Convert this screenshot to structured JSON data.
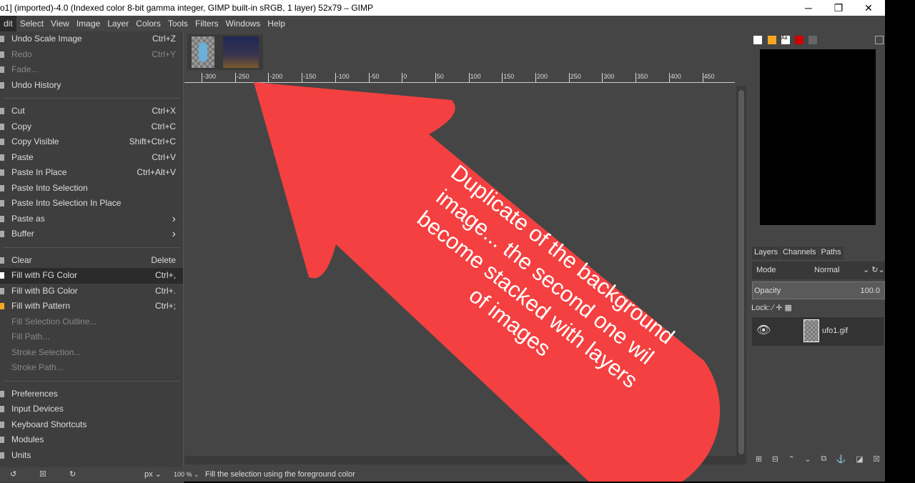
{
  "window": {
    "title": "o1] (imported)-4.0 (Indexed color 8-bit gamma integer, GIMP built-in sRGB, 1 layer) 52x79 – GIMP",
    "minimize": "─",
    "maximize": "❐",
    "close": "✕"
  },
  "menubar": [
    "dit",
    "Select",
    "View",
    "Image",
    "Layer",
    "Colors",
    "Tools",
    "Filters",
    "Windows",
    "Help"
  ],
  "edit_menu": [
    {
      "label": "Undo Scale Image",
      "shortcut": "Ctrl+Z",
      "icon": "undo-icon"
    },
    {
      "label": "Redo",
      "shortcut": "Ctrl+Y",
      "disabled": true,
      "icon": "redo-icon"
    },
    {
      "label": "Fade...",
      "disabled": true,
      "icon": "fade-icon"
    },
    {
      "label": "Undo History",
      "icon": "history-icon"
    },
    {
      "sep": true
    },
    {
      "label": "Cut",
      "shortcut": "Ctrl+X",
      "icon": "cut-icon"
    },
    {
      "label": "Copy",
      "shortcut": "Ctrl+C",
      "icon": "copy-icon"
    },
    {
      "label": "Copy Visible",
      "shortcut": "Shift+Ctrl+C",
      "icon": "copy-visible-icon"
    },
    {
      "label": "Paste",
      "shortcut": "Ctrl+V",
      "icon": "paste-icon"
    },
    {
      "label": "Paste In Place",
      "shortcut": "Ctrl+Alt+V",
      "icon": "paste-icon"
    },
    {
      "label": "Paste Into Selection",
      "icon": "paste-icon"
    },
    {
      "label": "Paste Into Selection In Place",
      "icon": "paste-icon"
    },
    {
      "label": "Paste as",
      "shortcut": "›",
      "icon": "paste-icon"
    },
    {
      "label": "Buffer",
      "shortcut": "›",
      "icon": "buffer-icon"
    },
    {
      "sep": true
    },
    {
      "label": "Clear",
      "shortcut": "Delete",
      "icon": "clear-icon"
    },
    {
      "label": "Fill with FG Color",
      "shortcut": "Ctrl+,",
      "highlight": true,
      "icon": "fg-color-icon"
    },
    {
      "label": "Fill with BG Color",
      "shortcut": "Ctrl+.",
      "icon": "bg-color-icon"
    },
    {
      "label": "Fill with Pattern",
      "shortcut": "Ctrl+;",
      "icon": "pattern-icon"
    },
    {
      "label": "Fill Selection Outline...",
      "disabled": true
    },
    {
      "label": "Fill Path...",
      "disabled": true
    },
    {
      "label": "Stroke Selection...",
      "disabled": true
    },
    {
      "label": "Stroke Path...",
      "disabled": true
    },
    {
      "sep": true
    },
    {
      "label": "Preferences",
      "icon": "preferences-icon"
    },
    {
      "label": "Input Devices",
      "icon": "input-devices-icon"
    },
    {
      "label": "Keyboard Shortcuts",
      "icon": "keyboard-icon"
    },
    {
      "label": "Modules",
      "icon": "modules-icon"
    },
    {
      "label": "Units",
      "icon": "units-icon"
    }
  ],
  "ruler_ticks": [
    "-300",
    "-250",
    "-200",
    "-150",
    "-100",
    "-50",
    "0",
    "50",
    "100",
    "150",
    "200",
    "250",
    "300",
    "350",
    "400",
    "450"
  ],
  "status": {
    "unit": "px",
    "zoom": "100 %",
    "message": "Fill the selection using the foreground color"
  },
  "layers_panel": {
    "tabs": [
      "Layers",
      "Channels",
      "Paths"
    ],
    "mode_label": "Mode",
    "mode_value": "Normal",
    "opacity_label": "Opacity",
    "opacity_value": "100.0",
    "lock_label": "Lock:",
    "layer_name": "ufo1.gif"
  },
  "annotation": {
    "lines": [
      "Duplicate of the background",
      "image... the second one wil",
      "become  stacked with layers",
      "of images"
    ],
    "color": "#f44040"
  }
}
